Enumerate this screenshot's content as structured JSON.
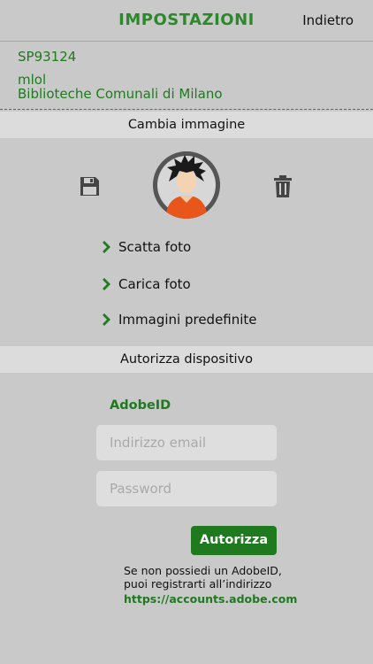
{
  "header": {
    "title": "IMPOSTAZIONI",
    "back_label": "Indietro"
  },
  "user": {
    "code": "SP93124",
    "name": "mlol",
    "library": "Biblioteche Comunali di Milano"
  },
  "image_section": {
    "title": "Cambia immagine",
    "save_icon": "floppy-disk-icon",
    "delete_icon": "trash-icon",
    "options": [
      {
        "label": "Scatta foto"
      },
      {
        "label": "Carica foto"
      },
      {
        "label": "Immagini predefinite"
      }
    ]
  },
  "authorize_section": {
    "title": "Autorizza dispositivo",
    "adobe_label": "AdobeID",
    "email_placeholder": "Indirizzo email",
    "password_placeholder": "Password",
    "button_label": "Autorizza",
    "note_line1": "Se non possiedi un AdobeID,",
    "note_line2": "puoi registrarti all’indirizzo",
    "note_link": "https://accounts.adobe.com"
  },
  "colors": {
    "accent": "#1f7a1f",
    "background": "#c9c9c9",
    "section_bar": "#dcdcdc"
  }
}
